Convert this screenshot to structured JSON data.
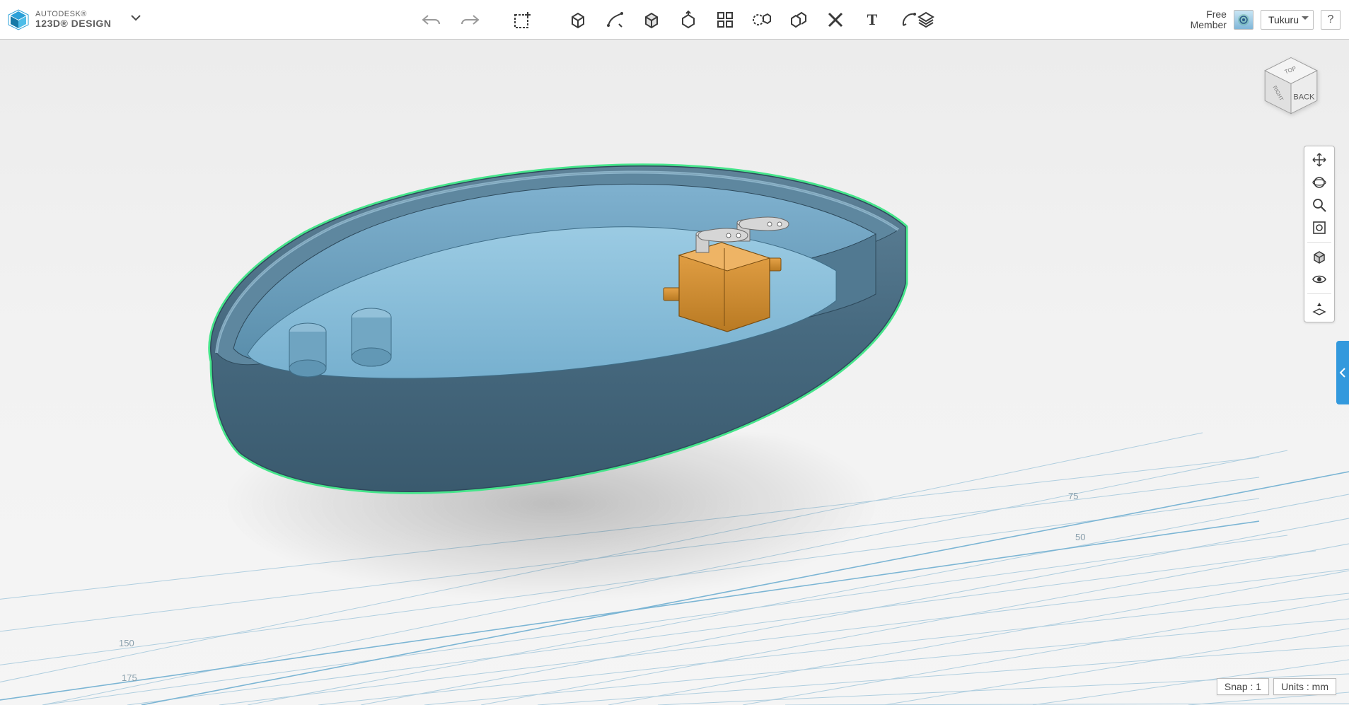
{
  "app": {
    "brand": "AUTODESK®",
    "name": "123D® DESIGN"
  },
  "toolbar": {
    "undo_tip": "Undo",
    "redo_tip": "Redo",
    "insert_tip": "Insert",
    "tools": {
      "primitives": "Primitives",
      "sketch": "Sketch",
      "construct": "Construct",
      "modify": "Modify",
      "pattern": "Pattern",
      "grouping": "Grouping",
      "combine": "Combine",
      "adjust": "Snap",
      "text": "Text",
      "measure": "Measure"
    },
    "materials_tip": "Materials"
  },
  "account": {
    "status_line1": "Free",
    "status_line2": "Member",
    "username": "Tukuru",
    "help": "?"
  },
  "viewcube": {
    "face": "BACK",
    "top": "TOP",
    "left": "RIGHT"
  },
  "rightbar": {
    "pan": "Pan",
    "orbit": "Orbit",
    "zoom": "Zoom",
    "fit": "Fit",
    "shaded": "Display",
    "visibility": "Visibility",
    "groundplane": "Toggles"
  },
  "status": {
    "snap_label": "Snap :",
    "snap_value": "1",
    "units_label": "Units :",
    "units_value": "mm"
  },
  "grid_ticks": {
    "a": "150",
    "b": "175",
    "c": "50",
    "d": "75"
  },
  "colors": {
    "hull_outer": "#4a6d82",
    "hull_inner": "#6ca0c1",
    "floor": "#86bdd9",
    "highlight": "#46e58b",
    "servo_body": "#d38a2a",
    "servo_horn": "#c6c6c6"
  }
}
